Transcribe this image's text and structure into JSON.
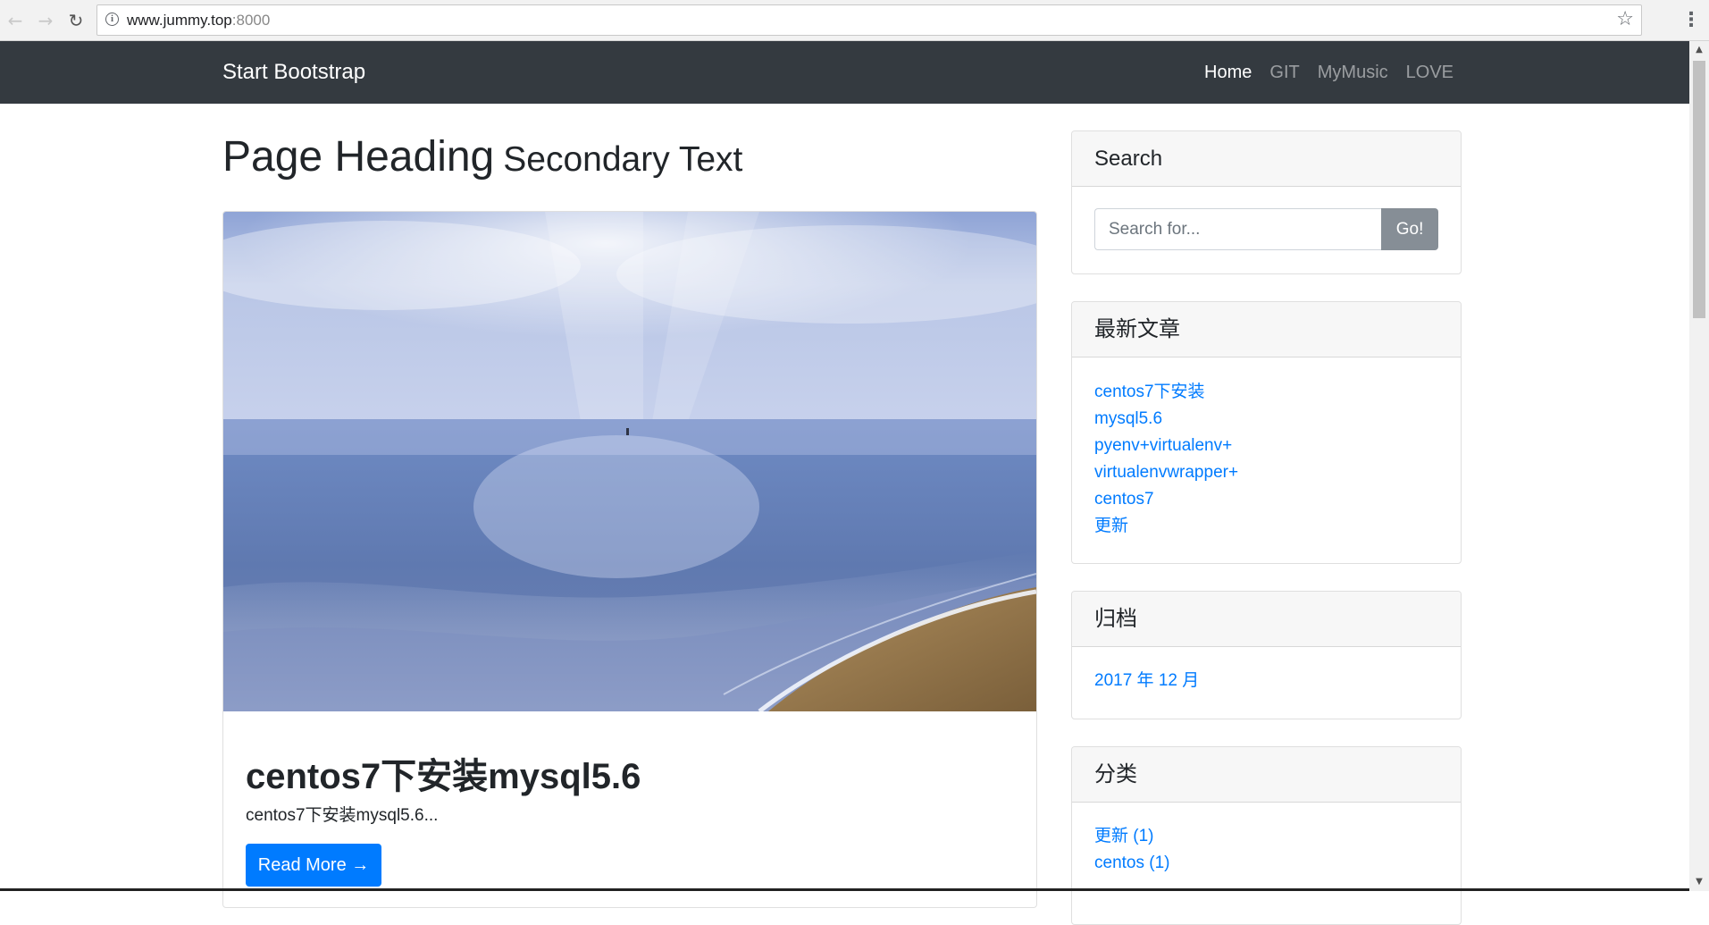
{
  "browser": {
    "url_host": "www.jummy.top",
    "url_port": ":8000",
    "back_icon": "←",
    "forward_icon": "→",
    "reload_icon": "↻",
    "info_icon": "i",
    "star_icon": "☆",
    "menu_icon": "⋮"
  },
  "navbar": {
    "brand": "Start Bootstrap",
    "links": [
      {
        "label": "Home",
        "active": true
      },
      {
        "label": "GIT"
      },
      {
        "label": "MyMusic"
      },
      {
        "label": "LOVE"
      }
    ]
  },
  "main": {
    "heading": "Page Heading",
    "heading_secondary": "Secondary Text",
    "post": {
      "title": "centos7下安装mysql5.6",
      "excerpt": "centos7下安装mysql5.6...",
      "read_more": "Read More →"
    }
  },
  "sidebar": {
    "search": {
      "title": "Search",
      "placeholder": "Search for...",
      "button": "Go!"
    },
    "recent": {
      "title": "最新文章",
      "lines": [
        "centos7下安装",
        "mysql5.6",
        "pyenv+virtualenv+",
        "virtualenvwrapper+",
        "centos7",
        "更新"
      ]
    },
    "archive": {
      "title": "归档",
      "items": [
        "2017 年 12 月"
      ]
    },
    "categories": {
      "title": "分类",
      "items": [
        "更新 (1)",
        "centos (1)"
      ]
    }
  },
  "colors": {
    "navbar_bg": "#343a40",
    "link": "#007bff",
    "primary_button": "#007bff",
    "secondary_button": "#868e96"
  }
}
